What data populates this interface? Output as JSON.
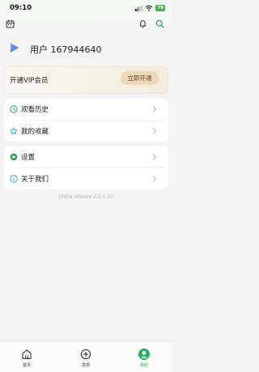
{
  "status_bar": {
    "time": "09:10",
    "battery": "79"
  },
  "user": {
    "name": "用户 167944640"
  },
  "vip": {
    "label": "开通VIP会员",
    "button_label": "立即开通"
  },
  "menu_group_1": [
    {
      "label": "观看历史",
      "icon": "clock-icon"
    },
    {
      "label": "我的收藏",
      "icon": "star-icon"
    }
  ],
  "menu_group_2": [
    {
      "label": "设置",
      "icon": "gear-icon"
    },
    {
      "label": "关于我们",
      "icon": "info-icon"
    }
  ],
  "version": "JiHDa release 2.2.5.30",
  "tabs": [
    {
      "label": "首页",
      "icon": "home-icon",
      "active": false
    },
    {
      "label": "发现",
      "icon": "discover-icon",
      "active": false
    },
    {
      "label": "我的",
      "icon": "profile-icon",
      "active": true
    }
  ],
  "colors": {
    "accent": "#27ae60",
    "vip_button": "#ecd8b8",
    "background": "#f3f3f4"
  }
}
